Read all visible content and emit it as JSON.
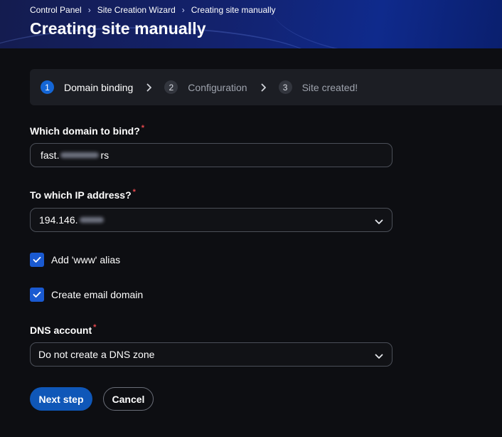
{
  "breadcrumb": {
    "items": [
      "Control Panel",
      "Site Creation Wizard",
      "Creating site manually"
    ],
    "separator": "›"
  },
  "page": {
    "title": "Creating site manually"
  },
  "stepper": {
    "steps": [
      {
        "number": "1",
        "label": "Domain binding",
        "active": true
      },
      {
        "number": "2",
        "label": "Configuration",
        "active": false
      },
      {
        "number": "3",
        "label": "Site created!",
        "active": false
      }
    ]
  },
  "form": {
    "domain": {
      "label": "Which domain to bind?",
      "required_mark": "*",
      "value_prefix": "fast.",
      "value_suffix": "rs"
    },
    "ip": {
      "label": "To which IP address?",
      "required_mark": "*",
      "value_prefix": "194.146."
    },
    "www_alias": {
      "label": "Add 'www' alias",
      "checked": true
    },
    "email_domain": {
      "label": "Create email domain",
      "checked": true
    },
    "dns": {
      "label": "DNS account",
      "required_mark": "*",
      "value": "Do not create a DNS zone"
    }
  },
  "actions": {
    "next_label": "Next step",
    "cancel_label": "Cancel"
  },
  "colors": {
    "accent": "#1466d6",
    "checkbox": "#1a5ad1",
    "primary_button": "#0f57b8",
    "required": "#e5484d",
    "background": "#0d0e12"
  },
  "icons": {
    "chevron_step": "chevron-right-icon",
    "select": "chevron-down-icon",
    "check": "check-icon"
  }
}
